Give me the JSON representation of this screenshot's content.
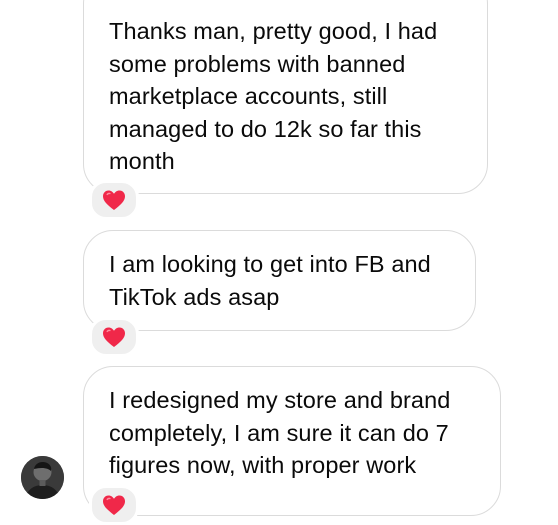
{
  "conversation": {
    "messages": [
      {
        "text": "Thanks man, pretty good, I had\nsome problems with banned\nmarketplace accounts, still\nmanaged to do 12k so far this\nmonth",
        "reaction": "heart-icon"
      },
      {
        "text": "I am looking to get into FB and\nTikTok ads asap",
        "reaction": "heart-icon"
      },
      {
        "text": "I redesigned my store and brand\ncompletely, I am sure it can do 7\nfigures now, with proper work",
        "reaction": "heart-icon"
      }
    ]
  },
  "colors": {
    "bubble_border": "#dbdbdb",
    "reaction_background": "#efefef",
    "heart": "#f02849",
    "text": "#0a0a0a"
  }
}
